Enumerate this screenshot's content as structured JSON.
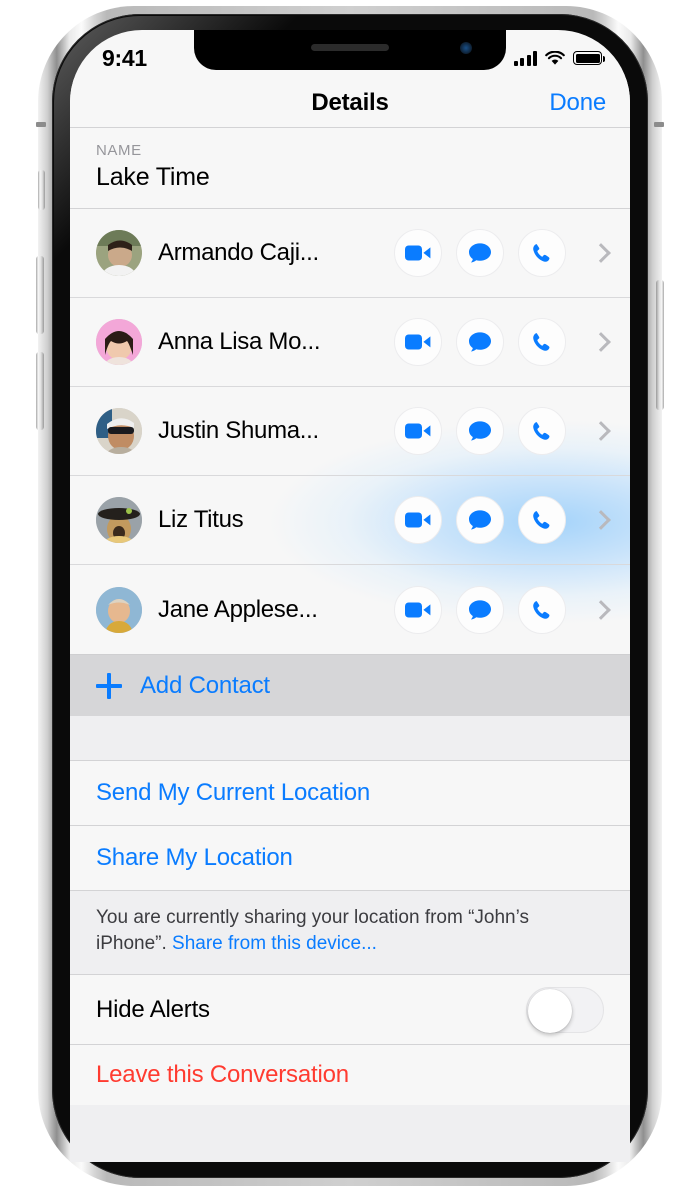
{
  "status_bar": {
    "time": "9:41",
    "signal_icon": "cellular-bars-icon",
    "signal_bars_filled": 4,
    "wifi_icon": "wifi-icon",
    "battery_icon": "battery-full-icon"
  },
  "nav": {
    "title": "Details",
    "done_label": "Done"
  },
  "name_section": {
    "label": "NAME",
    "value": "Lake Time"
  },
  "contacts": [
    {
      "name": "Armando Caji...",
      "avatar_colors": [
        "#6d7b58",
        "#caa98a",
        "#2e2119"
      ]
    },
    {
      "name": "Anna Lisa Mo...",
      "avatar_colors": [
        "#f3a7d8",
        "#f0c9ad",
        "#2b1c16"
      ]
    },
    {
      "name": "Justin Shuma...",
      "avatar_colors": [
        "#d9d4c9",
        "#c08c63",
        "#1a1a1e"
      ]
    },
    {
      "name": "Liz Titus",
      "avatar_colors": [
        "#9aa2a8",
        "#c29a5e",
        "#24201c"
      ]
    },
    {
      "name": "Jane Applese...",
      "avatar_colors": [
        "#8fb7d4",
        "#e6b88f",
        "#d8a93a"
      ]
    }
  ],
  "contact_actions": {
    "facetime_icon": "video-camera-icon",
    "message_icon": "message-bubble-icon",
    "call_icon": "phone-icon",
    "disclosure_icon": "chevron-right-icon"
  },
  "add_contact": {
    "icon": "plus-icon",
    "label": "Add Contact"
  },
  "location": {
    "send_current": "Send My Current Location",
    "share_my_location": "Share My Location",
    "note_text": "You are currently sharing your location from “John’s iPhone”. ",
    "note_link": "Share from this device..."
  },
  "hide_alerts": {
    "label": "Hide Alerts",
    "enabled": false
  },
  "leave": {
    "label": "Leave this Conversation"
  },
  "colors": {
    "accent_blue": "#0a7cff",
    "destructive_red": "#ff3b30",
    "separator": "#d3d3d5",
    "group_bg": "#efeff1",
    "cell_bg": "#f7f7f7",
    "highlight_blue": "#96cdfa"
  }
}
